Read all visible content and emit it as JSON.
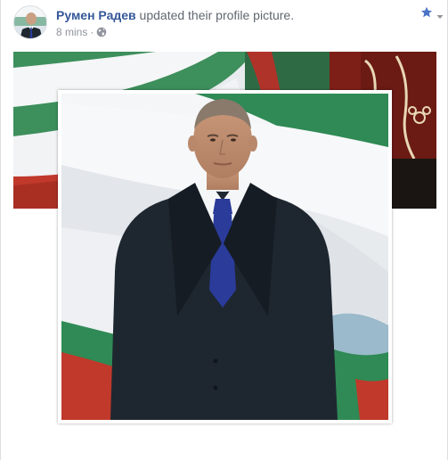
{
  "post": {
    "author_name": "Румен Радев",
    "action_text": " updated their profile picture.",
    "timestamp": "8 mins",
    "separator": "·",
    "audience_icon": "globe-icon",
    "favorite_icon": "star-icon",
    "menu_icon": "chevron-down-icon"
  },
  "colors": {
    "author_link": "#365899",
    "meta_text": "#90949c",
    "flag_white": "#f4f6f8",
    "flag_green": "#2f8a55",
    "flag_red": "#c0392b",
    "suit": "#1e2730",
    "tie": "#2a3b9a"
  }
}
